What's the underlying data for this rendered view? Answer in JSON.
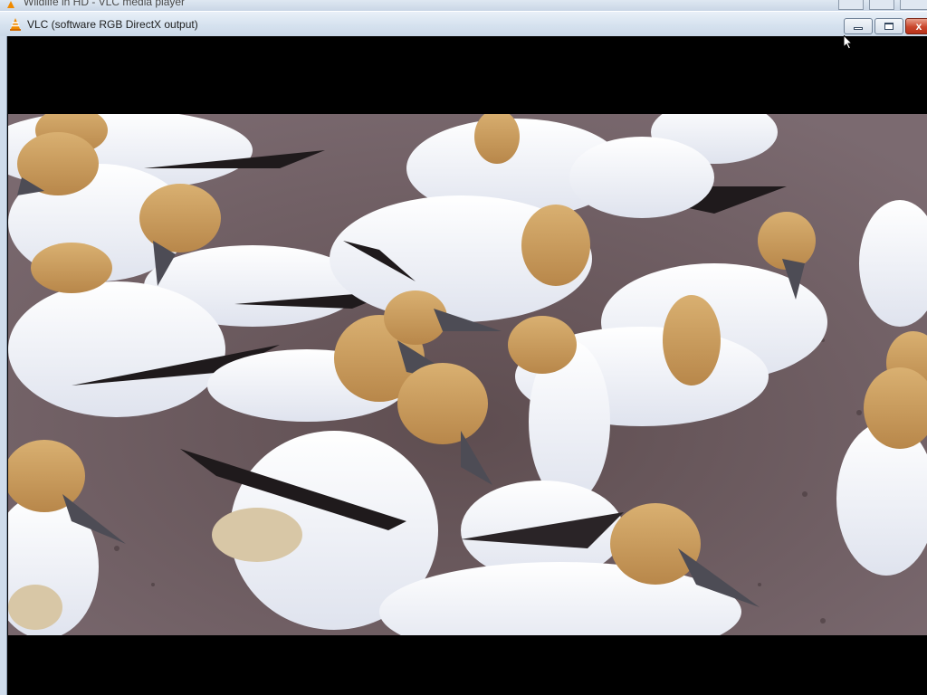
{
  "background_window": {
    "title": "Wildlife in HD - VLC media player"
  },
  "window": {
    "title": "VLC (software RGB DirectX output)",
    "controls": {
      "minimize_label": "",
      "maximize_label": "",
      "close_label": "x"
    }
  },
  "video": {
    "content": "gannet-colony-frame"
  },
  "colors": {
    "titlebar": "#d6e2ef",
    "close_button": "#c9462c",
    "letterbox": "#000000",
    "vlc_cone": "#f08a00"
  }
}
